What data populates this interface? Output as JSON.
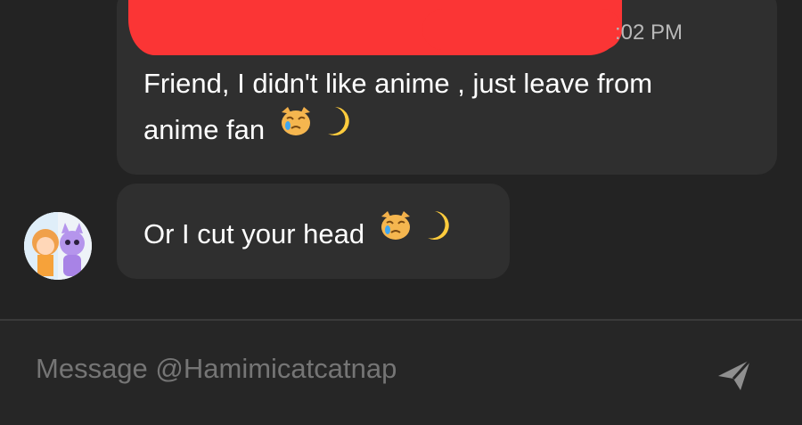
{
  "messages": [
    {
      "timestamp_visible": ":02 PM",
      "line1": "Friend, I didn't like anime , just leave from",
      "line2": "anime fan",
      "emojis": [
        "crying-cat-icon",
        "crescent-moon-icon"
      ]
    },
    {
      "text": "Or I cut your head",
      "emojis": [
        "crying-cat-icon",
        "crescent-moon-icon"
      ]
    }
  ],
  "composer": {
    "placeholder": "Message @Hamimicatcatnap",
    "send_icon": "send-icon"
  },
  "colors": {
    "background": "#232323",
    "bubble": "#2f2f2f",
    "redaction": "#fb3535",
    "text": "#ffffff",
    "muted": "#8f8f8f"
  }
}
